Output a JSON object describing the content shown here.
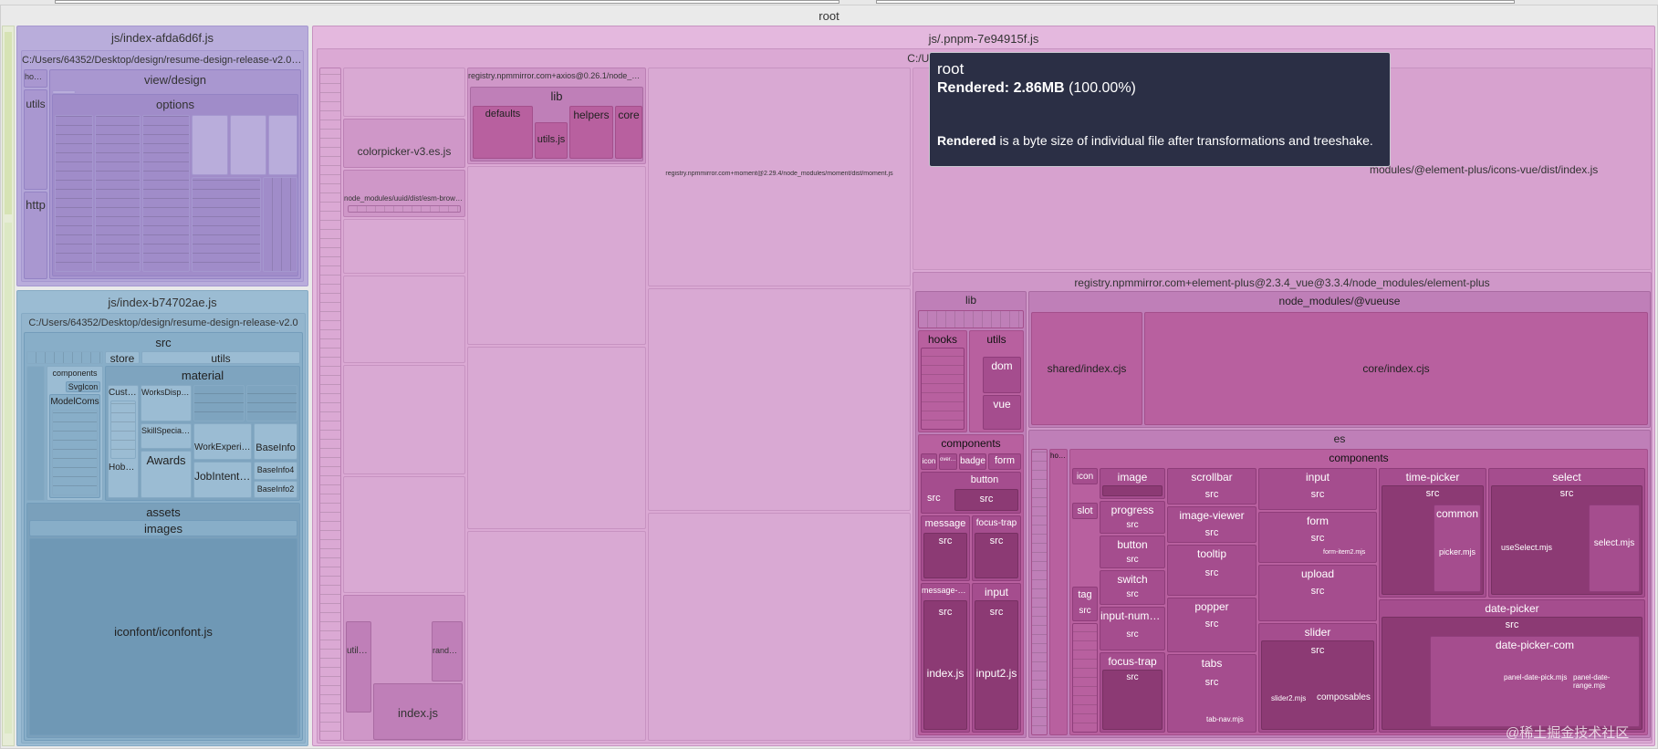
{
  "top_bar": {
    "root_label": "root"
  },
  "left": {
    "bundle_a": {
      "title": "js/index-afda6d6f.js",
      "path": "C:/Users/64352/Desktop/design/resume-design-release-v2.0/src",
      "hooks": "hooks",
      "utils": "utils",
      "http": "http",
      "view_design": "view/design",
      "options": "options"
    },
    "bundle_b": {
      "title": "js/index-b74702ae.js",
      "path": "C:/Users/64352/Desktop/design/resume-design-release-v2.0",
      "src": "src",
      "store": "store",
      "utils": "utils",
      "components": "components",
      "svgicon": "SvgIcon",
      "modelcoms": "ModelComs",
      "material": "material",
      "custom": "Custom",
      "works_display": "WorksDisplay",
      "skill_specialties": "SkillSpecialties",
      "awards": "Awards",
      "work_experience": "WorkExperience",
      "base_info": "BaseInfo",
      "hobbies": "Hobbies",
      "job_intention": "JobIntention",
      "base_info4": "BaseInfo4",
      "base_info2": "BaseInfo2",
      "assets": "assets",
      "images": "images",
      "iconfont": "iconfont/iconfont.js"
    }
  },
  "pnpm": {
    "title": "js/.pnpm-7e94915f.js",
    "path": "C:/Users/64352/Desktop/design",
    "colorpicker": "colorpicker-v3.es.js",
    "axios": "registry.npmmirror.com+axios@0.26.1/node_modules/axios",
    "lib": "lib",
    "defaults": "defaults",
    "utils_js": "utils.js",
    "helpers": "helpers",
    "core": "core",
    "moment": "registry.npmmirror.com+moment@2.29.4/node_modules/moment/dist/moment.js",
    "uuid": "node_modules/uuid/dist/esm-browser",
    "utils_js2": "utils.js",
    "random_js": "random.js",
    "index_js": "index.js",
    "icons_vue": "modules/@element-plus/icons-vue/dist/index.js",
    "element_plus": "registry.npmmirror.com+element-plus@2.3.4_vue@3.3.4/node_modules/element-plus",
    "ep_lib": "lib",
    "vueuse": "node_modules/@vueuse",
    "shared": "shared/index.cjs",
    "core_cjs": "core/index.cjs",
    "hooks": "hooks",
    "utils": "utils",
    "dom": "dom",
    "vue": "vue",
    "components": "components",
    "icon": "icon",
    "overlay": "overlay",
    "badge": "badge",
    "form": "form",
    "button": "button",
    "src": "src",
    "message": "message",
    "focus_trap": "focus-trap",
    "message_box": "message-box",
    "input": "input",
    "index_js2": "index.js",
    "input2_js": "input2.js",
    "es": "es",
    "es_components": "components",
    "es_hooks": "hooks",
    "es_icon": "icon",
    "slot": "slot",
    "tag": "tag",
    "image": "image",
    "progress": "progress",
    "es_button": "button",
    "switch": "switch",
    "input_number": "input-number",
    "es_focus_trap": "focus-trap",
    "scrollbar": "scrollbar",
    "image_viewer": "image-viewer",
    "tooltip": "tooltip",
    "popper": "popper",
    "tabs": "tabs",
    "tab_nav": "tab-nav.mjs",
    "es_input": "input",
    "es_form": "form",
    "form_item2": "form-item2.mjs",
    "upload": "upload",
    "slider": "slider",
    "slider2": "slider2.mjs",
    "composables": "composables",
    "time_picker": "time-picker",
    "common": "common",
    "picker_mjs": "picker.mjs",
    "select": "select",
    "use_select": "useSelect.mjs",
    "select_mjs": "select.mjs",
    "date_picker": "date-picker",
    "date_picker_com": "date-picker-com",
    "panel_date_pick": "panel-date-pick.mjs",
    "panel_date_range": "panel-date-range.mjs"
  },
  "tooltip": {
    "title": "root",
    "rendered_label": "Rendered:",
    "rendered_value": "2.86MB",
    "rendered_pct": "(100.00%)",
    "desc_bold": "Rendered",
    "desc_rest": " is a byte size of individual file after transformations and treeshake."
  },
  "watermark": "@稀土掘金技术社区"
}
